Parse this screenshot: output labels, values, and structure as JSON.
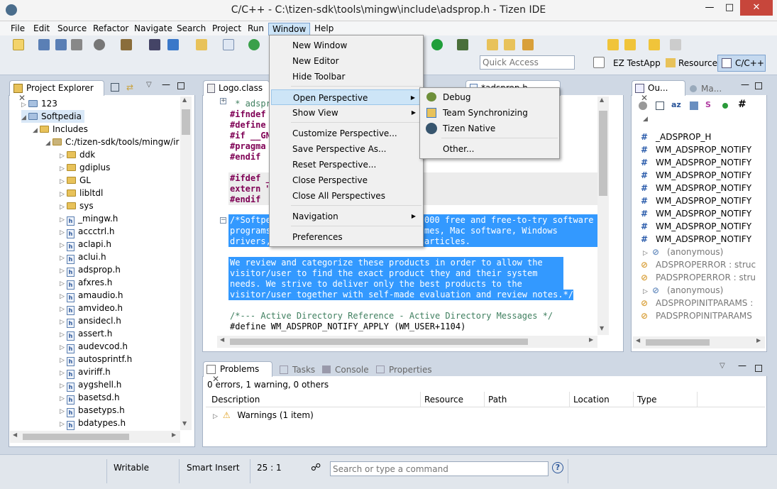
{
  "window": {
    "title": "C/C++ - C:\\tizen-sdk\\tools\\mingw\\include\\adsprop.h - Tizen IDE"
  },
  "menubar": [
    "File",
    "Edit",
    "Source",
    "Refactor",
    "Navigate",
    "Search",
    "Project",
    "Run",
    "Window",
    "Help"
  ],
  "toolbar": {
    "quick_access_placeholder": "Quick Access",
    "ez_testapp": "EZ TestApp",
    "resource": "Resource",
    "cpp": "C/C++"
  },
  "project_explorer": {
    "title": "Project Explorer",
    "items": [
      {
        "label": "123"
      },
      {
        "label": "Softpedia"
      },
      {
        "label": "Includes"
      },
      {
        "label": "C:/tizen-sdk/tools/mingw/ir"
      },
      {
        "label": "ddk"
      },
      {
        "label": "gdiplus"
      },
      {
        "label": "GL"
      },
      {
        "label": "libltdl"
      },
      {
        "label": "sys"
      },
      {
        "label": "_mingw.h"
      },
      {
        "label": "accctrl.h"
      },
      {
        "label": "aclapi.h"
      },
      {
        "label": "aclui.h"
      },
      {
        "label": "adsprop.h"
      },
      {
        "label": "afxres.h"
      },
      {
        "label": "amaudio.h"
      },
      {
        "label": "amvideo.h"
      },
      {
        "label": "ansidecl.h"
      },
      {
        "label": "assert.h"
      },
      {
        "label": "audevcod.h"
      },
      {
        "label": "autosprintf.h"
      },
      {
        "label": "aviriff.h"
      },
      {
        "label": "aygshell.h"
      },
      {
        "label": "basetsd.h"
      },
      {
        "label": "basetyps.h"
      },
      {
        "label": "bdatypes.h"
      }
    ]
  },
  "editor": {
    "tab": "Logo.class",
    "tab3": "*adsprop.h",
    "lines": {
      "l0": " * adspr",
      "l1a": "#ifndef",
      "l2a": "#define",
      "l3a": "#if __GN",
      "l4a": "#pragma",
      "l5a": "#endif",
      "l6a": "#ifdef _",
      "l7a": "extern \"",
      "l8a": "#endif",
      "s1a": "/*Softpe",
      "s1b": "000 free and free-to-try software",
      "s2a": "programs",
      "s2b": "mes, Mac software, Windows",
      "s3a": "drivers,",
      "s3b": "articles.",
      "s5": "We review and categorize these products in order to allow the",
      "s6": "visitor/user to find the exact product they and their system",
      "s7": "needs. We strive to deliver only the best products to the",
      "s8": "visitor/user together with self-made evaluation and review notes.*/",
      "c1": "/*--- Active Directory Reference - Active Directory Messages */",
      "c2": "#define WM_ADSPROP_NOTIFY_APPLY (WM_USER+1104)"
    }
  },
  "window_menu": {
    "items": [
      "New Window",
      "New Editor",
      "Hide Toolbar",
      "Open Perspective",
      "Show View",
      "Customize Perspective...",
      "Save Perspective As...",
      "Reset Perspective...",
      "Close Perspective",
      "Close All Perspectives",
      "Navigation",
      "Preferences"
    ]
  },
  "perspective_submenu": {
    "items": [
      "Debug",
      "Team Synchronizing",
      "Tizen Native",
      "Other..."
    ]
  },
  "outline": {
    "tab1": "Ou...",
    "tab2": "Ma...",
    "items": [
      "_ADSPROP_H",
      "WM_ADSPROP_NOTIFY",
      "WM_ADSPROP_NOTIFY",
      "WM_ADSPROP_NOTIFY",
      "WM_ADSPROP_NOTIFY",
      "WM_ADSPROP_NOTIFY",
      "WM_ADSPROP_NOTIFY",
      "WM_ADSPROP_NOTIFY",
      "WM_ADSPROP_NOTIFY",
      "(anonymous)",
      "ADSPROPERROR : struc",
      "PADSPROPERROR : stru",
      "(anonymous)",
      "ADSPROPINITPARAMS :",
      "PADSPROPINITPARAMS"
    ]
  },
  "bottom": {
    "tabs": [
      "Problems",
      "Tasks",
      "Console",
      "Properties"
    ],
    "summary": "0 errors, 1 warning, 0 others",
    "columns": [
      "Description",
      "Resource",
      "Path",
      "Location",
      "Type"
    ],
    "row": "Warnings (1 item)"
  },
  "status": {
    "writable": "Writable",
    "mode": "Smart Insert",
    "pos": "25 : 1",
    "command_placeholder": "Search or type a command"
  }
}
